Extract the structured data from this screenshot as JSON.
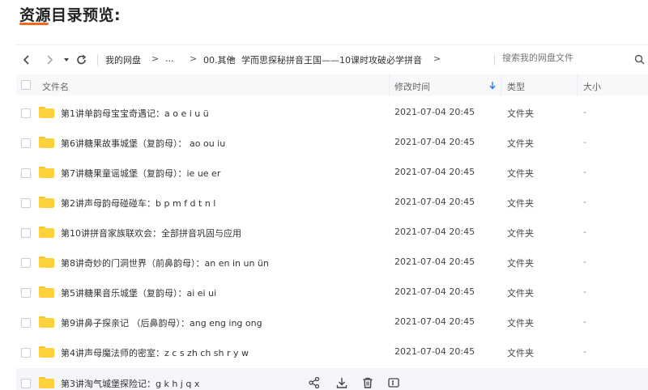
{
  "page": {
    "heading": "资源目录预览:"
  },
  "toolbar": {
    "breadcrumbs": [
      "我的网盘",
      "...",
      "00.其他",
      "学而思探秘拼音王国——10课时攻破必学拼音"
    ],
    "separator": ">",
    "search_placeholder": "搜索我的网盘文件"
  },
  "table": {
    "columns": {
      "name": "文件名",
      "modified": "修改时间",
      "type": "类型",
      "size": "大小"
    },
    "sort": {
      "column": "modified",
      "direction": "descending"
    },
    "rows": [
      {
        "name": "第1讲单韵母宝宝奇遇记：a o e i u ü",
        "modified": "2021-07-04 20:45",
        "type": "文件夹",
        "size": "-"
      },
      {
        "name": "第6讲糖果故事城堡（复韵母）：  ao ou iu",
        "modified": "2021-07-04 20:45",
        "type": "文件夹",
        "size": "-"
      },
      {
        "name": "第7讲糖果童谣城堡（复韵母）：ie ue er",
        "modified": "2021-07-04 20:45",
        "type": "文件夹",
        "size": "-"
      },
      {
        "name": "第2讲声母韵母碰碰车：b p m f d t n l",
        "modified": "2021-07-04 20:45",
        "type": "文件夹",
        "size": "-"
      },
      {
        "name": "第10讲拼音家族联欢会：全部拼音巩固与应用",
        "modified": "2021-07-04 20:45",
        "type": "文件夹",
        "size": "-"
      },
      {
        "name": "第8讲奇妙的门洞世界（前鼻韵母）：an en in un ün",
        "modified": "2021-07-04 20:45",
        "type": "文件夹",
        "size": "-"
      },
      {
        "name": "第5讲糖果音乐城堡（复韵母）：ai ei ui",
        "modified": "2021-07-04 20:45",
        "type": "文件夹",
        "size": "-"
      },
      {
        "name": "第9讲鼻子探亲记 （后鼻韵母）：ang eng ing ong",
        "modified": "2021-07-04 20:45",
        "type": "文件夹",
        "size": "-"
      },
      {
        "name": "第4讲声母魔法师的密室：z c s zh ch sh r y w",
        "modified": "2021-07-04 20:45",
        "type": "文件夹",
        "size": "-"
      },
      {
        "name": "第3讲淘气城堡探险记：g k h j q x",
        "modified": "",
        "type": "",
        "size": ""
      }
    ]
  },
  "icons": {
    "back": "chevron-left-icon",
    "forward": "chevron-right-icon",
    "history": "caret-down-icon",
    "refresh": "refresh-icon",
    "search": "search-icon",
    "share": "share-icon",
    "download": "download-icon",
    "delete": "trash-icon",
    "more": "rename-icon",
    "folder": "folder-icon"
  },
  "colors": {
    "accent": "#f06a1f",
    "sort_arrow": "#2f7cf6",
    "folder": "#fdd23c",
    "header_bg": "#f7f8fa"
  }
}
